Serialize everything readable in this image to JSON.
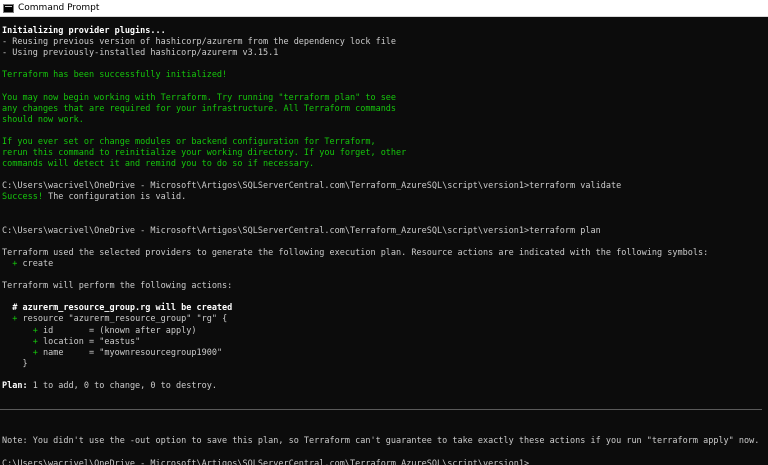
{
  "window": {
    "title": "Command Prompt",
    "icon": "cmd-icon"
  },
  "colors": {
    "background": "#0c0c0c",
    "text": "#cccccc",
    "green": "#16c60c"
  },
  "console": {
    "lines": [
      {
        "text": "Initializing provider plugins...",
        "style": "b"
      },
      {
        "text": "- Reusing previous version of hashicorp/azurerm from the dependency lock file",
        "style": ""
      },
      {
        "text": "- Using previously-installed hashicorp/azurerm v3.15.1",
        "style": ""
      },
      {
        "text": "",
        "style": ""
      },
      {
        "text": "Terraform has been successfully initialized!",
        "style": "g"
      },
      {
        "text": "",
        "style": ""
      },
      {
        "text": "You may now begin working with Terraform. Try running \"terraform plan\" to see",
        "style": "g"
      },
      {
        "text": "any changes that are required for your infrastructure. All Terraform commands",
        "style": "g"
      },
      {
        "text": "should now work.",
        "style": "g"
      },
      {
        "text": "",
        "style": ""
      },
      {
        "text": "If you ever set or change modules or backend configuration for Terraform,",
        "style": "g"
      },
      {
        "text": "rerun this command to reinitialize your working directory. If you forget, other",
        "style": "g"
      },
      {
        "text": "commands will detect it and remind you to do so if necessary.",
        "style": "g"
      },
      {
        "text": "",
        "style": ""
      },
      {
        "text": "C:\\Users\\wacrivel\\OneDrive - Microsoft\\Artigos\\SQLServerCentral.com\\Terraform_AzureSQL\\script\\version1>terraform validate",
        "style": ""
      },
      {
        "text": "Success!",
        "style": "g",
        "rest": " The configuration is valid."
      },
      {
        "text": "",
        "style": ""
      },
      {
        "text": "",
        "style": ""
      },
      {
        "text": "C:\\Users\\wacrivel\\OneDrive - Microsoft\\Artigos\\SQLServerCentral.com\\Terraform_AzureSQL\\script\\version1>terraform plan",
        "style": ""
      },
      {
        "text": "",
        "style": ""
      },
      {
        "text": "Terraform used the selected providers to generate the following execution plan. Resource actions are indicated with the following symbols:",
        "style": ""
      },
      {
        "text": "  + create",
        "style": "g",
        "prefix": "  ",
        "gpart": "+",
        "rest": " create"
      },
      {
        "text": "",
        "style": ""
      },
      {
        "text": "Terraform will perform the following actions:",
        "style": ""
      },
      {
        "text": "",
        "style": ""
      },
      {
        "text": "  # azurerm_resource_group.rg will be created",
        "style": "b"
      },
      {
        "text": "  + resource \"azurerm_resource_group\" \"rg\" {",
        "style": "mix",
        "prefix": "  ",
        "gpart": "+",
        "rest": " resource \"azurerm_resource_group\" \"rg\" {"
      },
      {
        "text": "      + id       = (known after apply)",
        "style": "mix",
        "prefix": "      ",
        "gpart": "+",
        "rest": " id       = (known after apply)"
      },
      {
        "text": "      + location = \"eastus\"",
        "style": "mix",
        "prefix": "      ",
        "gpart": "+",
        "rest": " location = \"eastus\""
      },
      {
        "text": "      + name     = \"myownresourcegroup1900\"",
        "style": "mix",
        "prefix": "      ",
        "gpart": "+",
        "rest": " name     = \"myownresourcegroup1900\""
      },
      {
        "text": "    }",
        "style": ""
      },
      {
        "text": "",
        "style": ""
      },
      {
        "text": "Plan: 1 to add, 0 to change, 0 to destroy.",
        "style": "planline",
        "bpart": "Plan:",
        "rest": " 1 to add, 0 to change, 0 to destroy."
      },
      {
        "text": "",
        "style": ""
      },
      {
        "text": "",
        "style": ""
      },
      {
        "text": "",
        "style": ""
      },
      {
        "text": "",
        "style": ""
      },
      {
        "text": "Note: You didn't use the -out option to save this plan, so Terraform can't guarantee to take exactly these actions if you run \"terraform apply\" now.",
        "style": ""
      },
      {
        "text": "",
        "style": ""
      },
      {
        "text": "C:\\Users\\wacrivel\\OneDrive - Microsoft\\Artigos\\SQLServerCentral.com\\Terraform_AzureSQL\\script\\version1>",
        "style": ""
      }
    ]
  }
}
